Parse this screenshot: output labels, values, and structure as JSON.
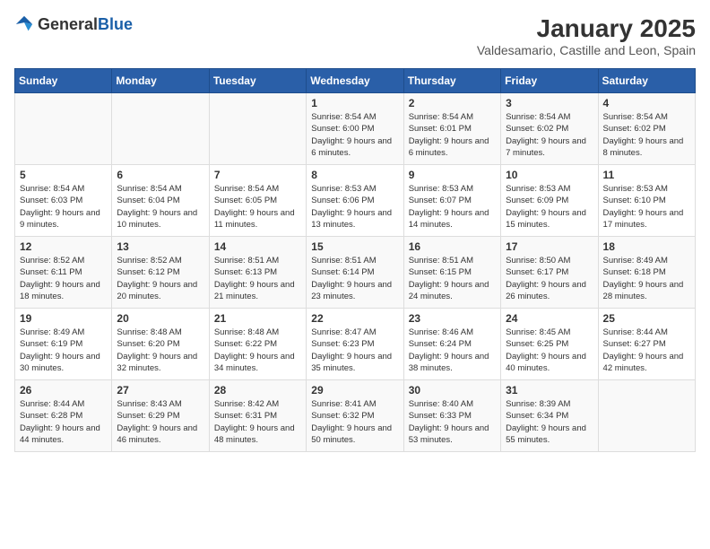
{
  "header": {
    "logo_general": "General",
    "logo_blue": "Blue",
    "month": "January 2025",
    "location": "Valdesamario, Castille and Leon, Spain"
  },
  "weekdays": [
    "Sunday",
    "Monday",
    "Tuesday",
    "Wednesday",
    "Thursday",
    "Friday",
    "Saturday"
  ],
  "weeks": [
    [
      {
        "day": "",
        "sunrise": "",
        "sunset": "",
        "daylight": ""
      },
      {
        "day": "",
        "sunrise": "",
        "sunset": "",
        "daylight": ""
      },
      {
        "day": "",
        "sunrise": "",
        "sunset": "",
        "daylight": ""
      },
      {
        "day": "1",
        "sunrise": "Sunrise: 8:54 AM",
        "sunset": "Sunset: 6:00 PM",
        "daylight": "Daylight: 9 hours and 6 minutes."
      },
      {
        "day": "2",
        "sunrise": "Sunrise: 8:54 AM",
        "sunset": "Sunset: 6:01 PM",
        "daylight": "Daylight: 9 hours and 6 minutes."
      },
      {
        "day": "3",
        "sunrise": "Sunrise: 8:54 AM",
        "sunset": "Sunset: 6:02 PM",
        "daylight": "Daylight: 9 hours and 7 minutes."
      },
      {
        "day": "4",
        "sunrise": "Sunrise: 8:54 AM",
        "sunset": "Sunset: 6:02 PM",
        "daylight": "Daylight: 9 hours and 8 minutes."
      }
    ],
    [
      {
        "day": "5",
        "sunrise": "Sunrise: 8:54 AM",
        "sunset": "Sunset: 6:03 PM",
        "daylight": "Daylight: 9 hours and 9 minutes."
      },
      {
        "day": "6",
        "sunrise": "Sunrise: 8:54 AM",
        "sunset": "Sunset: 6:04 PM",
        "daylight": "Daylight: 9 hours and 10 minutes."
      },
      {
        "day": "7",
        "sunrise": "Sunrise: 8:54 AM",
        "sunset": "Sunset: 6:05 PM",
        "daylight": "Daylight: 9 hours and 11 minutes."
      },
      {
        "day": "8",
        "sunrise": "Sunrise: 8:53 AM",
        "sunset": "Sunset: 6:06 PM",
        "daylight": "Daylight: 9 hours and 13 minutes."
      },
      {
        "day": "9",
        "sunrise": "Sunrise: 8:53 AM",
        "sunset": "Sunset: 6:07 PM",
        "daylight": "Daylight: 9 hours and 14 minutes."
      },
      {
        "day": "10",
        "sunrise": "Sunrise: 8:53 AM",
        "sunset": "Sunset: 6:09 PM",
        "daylight": "Daylight: 9 hours and 15 minutes."
      },
      {
        "day": "11",
        "sunrise": "Sunrise: 8:53 AM",
        "sunset": "Sunset: 6:10 PM",
        "daylight": "Daylight: 9 hours and 17 minutes."
      }
    ],
    [
      {
        "day": "12",
        "sunrise": "Sunrise: 8:52 AM",
        "sunset": "Sunset: 6:11 PM",
        "daylight": "Daylight: 9 hours and 18 minutes."
      },
      {
        "day": "13",
        "sunrise": "Sunrise: 8:52 AM",
        "sunset": "Sunset: 6:12 PM",
        "daylight": "Daylight: 9 hours and 20 minutes."
      },
      {
        "day": "14",
        "sunrise": "Sunrise: 8:51 AM",
        "sunset": "Sunset: 6:13 PM",
        "daylight": "Daylight: 9 hours and 21 minutes."
      },
      {
        "day": "15",
        "sunrise": "Sunrise: 8:51 AM",
        "sunset": "Sunset: 6:14 PM",
        "daylight": "Daylight: 9 hours and 23 minutes."
      },
      {
        "day": "16",
        "sunrise": "Sunrise: 8:51 AM",
        "sunset": "Sunset: 6:15 PM",
        "daylight": "Daylight: 9 hours and 24 minutes."
      },
      {
        "day": "17",
        "sunrise": "Sunrise: 8:50 AM",
        "sunset": "Sunset: 6:17 PM",
        "daylight": "Daylight: 9 hours and 26 minutes."
      },
      {
        "day": "18",
        "sunrise": "Sunrise: 8:49 AM",
        "sunset": "Sunset: 6:18 PM",
        "daylight": "Daylight: 9 hours and 28 minutes."
      }
    ],
    [
      {
        "day": "19",
        "sunrise": "Sunrise: 8:49 AM",
        "sunset": "Sunset: 6:19 PM",
        "daylight": "Daylight: 9 hours and 30 minutes."
      },
      {
        "day": "20",
        "sunrise": "Sunrise: 8:48 AM",
        "sunset": "Sunset: 6:20 PM",
        "daylight": "Daylight: 9 hours and 32 minutes."
      },
      {
        "day": "21",
        "sunrise": "Sunrise: 8:48 AM",
        "sunset": "Sunset: 6:22 PM",
        "daylight": "Daylight: 9 hours and 34 minutes."
      },
      {
        "day": "22",
        "sunrise": "Sunrise: 8:47 AM",
        "sunset": "Sunset: 6:23 PM",
        "daylight": "Daylight: 9 hours and 35 minutes."
      },
      {
        "day": "23",
        "sunrise": "Sunrise: 8:46 AM",
        "sunset": "Sunset: 6:24 PM",
        "daylight": "Daylight: 9 hours and 38 minutes."
      },
      {
        "day": "24",
        "sunrise": "Sunrise: 8:45 AM",
        "sunset": "Sunset: 6:25 PM",
        "daylight": "Daylight: 9 hours and 40 minutes."
      },
      {
        "day": "25",
        "sunrise": "Sunrise: 8:44 AM",
        "sunset": "Sunset: 6:27 PM",
        "daylight": "Daylight: 9 hours and 42 minutes."
      }
    ],
    [
      {
        "day": "26",
        "sunrise": "Sunrise: 8:44 AM",
        "sunset": "Sunset: 6:28 PM",
        "daylight": "Daylight: 9 hours and 44 minutes."
      },
      {
        "day": "27",
        "sunrise": "Sunrise: 8:43 AM",
        "sunset": "Sunset: 6:29 PM",
        "daylight": "Daylight: 9 hours and 46 minutes."
      },
      {
        "day": "28",
        "sunrise": "Sunrise: 8:42 AM",
        "sunset": "Sunset: 6:31 PM",
        "daylight": "Daylight: 9 hours and 48 minutes."
      },
      {
        "day": "29",
        "sunrise": "Sunrise: 8:41 AM",
        "sunset": "Sunset: 6:32 PM",
        "daylight": "Daylight: 9 hours and 50 minutes."
      },
      {
        "day": "30",
        "sunrise": "Sunrise: 8:40 AM",
        "sunset": "Sunset: 6:33 PM",
        "daylight": "Daylight: 9 hours and 53 minutes."
      },
      {
        "day": "31",
        "sunrise": "Sunrise: 8:39 AM",
        "sunset": "Sunset: 6:34 PM",
        "daylight": "Daylight: 9 hours and 55 minutes."
      },
      {
        "day": "",
        "sunrise": "",
        "sunset": "",
        "daylight": ""
      }
    ]
  ]
}
